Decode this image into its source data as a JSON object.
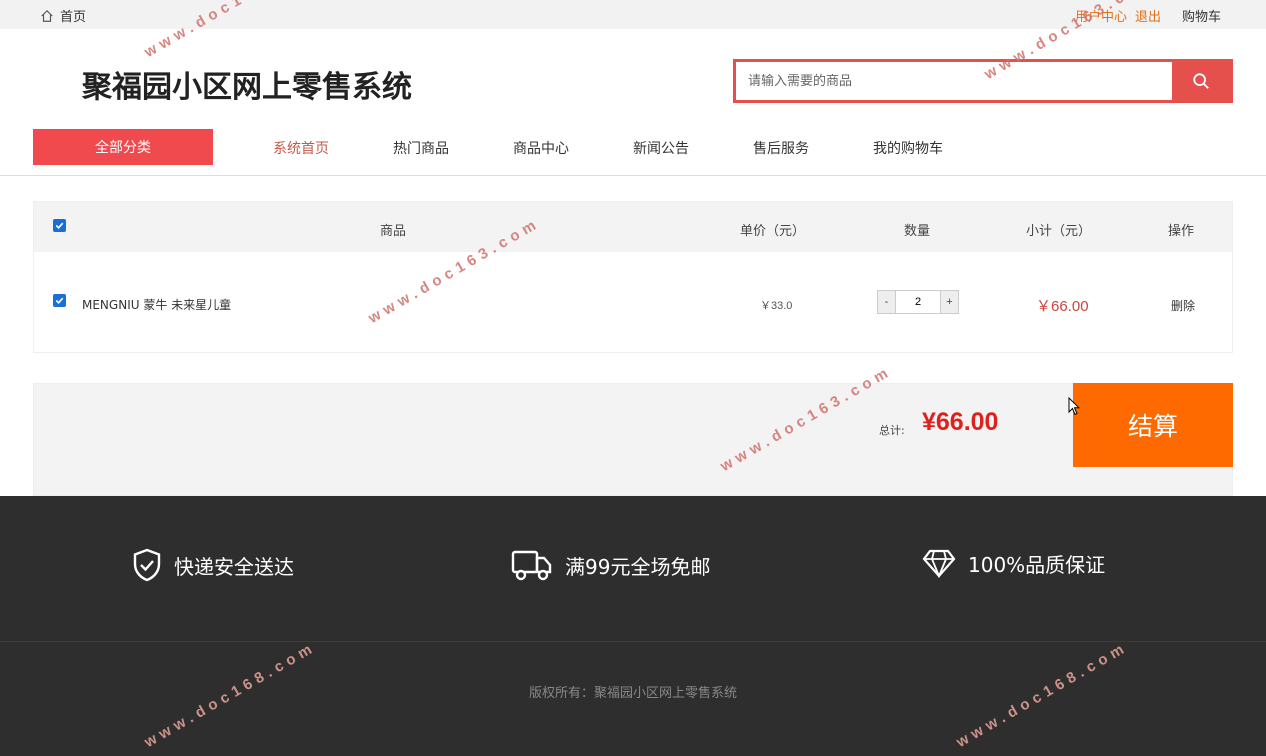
{
  "topbar": {
    "home_label": "首页",
    "user_center": "用户中心",
    "logout": "退出",
    "cart": "购物车"
  },
  "header": {
    "site_title": "聚福园小区网上零售系统",
    "search_placeholder": "请输入需要的商品"
  },
  "nav": {
    "all_categories": "全部分类",
    "items": [
      {
        "label": "系统首页",
        "active": true
      },
      {
        "label": "热门商品",
        "active": false
      },
      {
        "label": "商品中心",
        "active": false
      },
      {
        "label": "新闻公告",
        "active": false
      },
      {
        "label": "售后服务",
        "active": false
      },
      {
        "label": "我的购物车",
        "active": false
      }
    ]
  },
  "cart": {
    "columns": {
      "product": "商品",
      "unit_price": "单价（元）",
      "quantity": "数量",
      "subtotal": "小计（元）",
      "action": "操作"
    },
    "select_all_checked": true,
    "items": [
      {
        "checked": true,
        "name": "MENGNIU 蒙牛 未来星儿童",
        "unit_price": "￥33.0",
        "quantity": "2",
        "subtotal": "￥66.00",
        "action": "删除"
      }
    ],
    "minus_label": "-",
    "plus_label": "+"
  },
  "summary": {
    "total_label": "总计:",
    "total_value": "¥66.00",
    "checkout_label": "结算"
  },
  "footer": {
    "features": [
      {
        "icon": "shield-check-icon",
        "label": "快递安全送达"
      },
      {
        "icon": "truck-icon",
        "label": "满99元全场免邮"
      },
      {
        "icon": "diamond-icon",
        "label": "100%品质保证"
      }
    ],
    "copyright": "版权所有：聚福园小区网上零售系统"
  },
  "watermarks": {
    "primary": "www.doc163.com",
    "secondary": "www.doc168.com"
  },
  "colors": {
    "accent_red": "#f04a4f",
    "price_red": "#e0201c",
    "checkout_orange": "#ff6a00",
    "link_orange": "#e0701a",
    "footer_bg": "#2e2e2e"
  }
}
